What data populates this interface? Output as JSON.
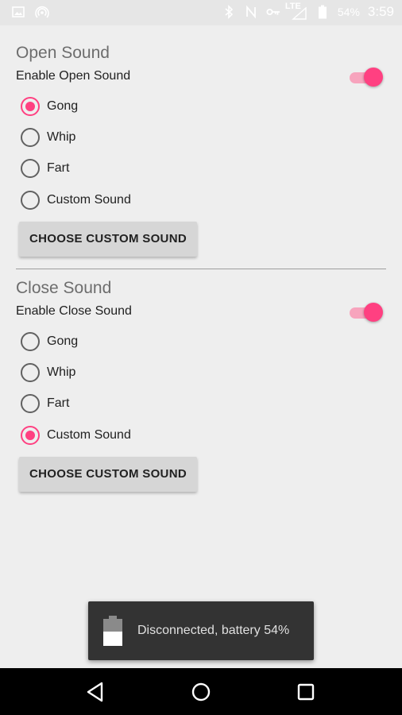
{
  "status_bar": {
    "battery_text": "54%",
    "time": "3:59",
    "network": "LTE",
    "icons": [
      "image-icon",
      "hotspot-icon",
      "bluetooth-icon",
      "nfc-icon",
      "vpn-key-icon",
      "signal-icon",
      "battery-icon"
    ]
  },
  "open_section": {
    "title": "Open Sound",
    "enable_label": "Enable Open Sound",
    "enabled": true,
    "options": [
      {
        "label": "Gong",
        "selected": true
      },
      {
        "label": "Whip",
        "selected": false
      },
      {
        "label": "Fart",
        "selected": false
      },
      {
        "label": "Custom Sound",
        "selected": false
      }
    ],
    "button_label": "CHOOSE CUSTOM SOUND"
  },
  "close_section": {
    "title": "Close Sound",
    "enable_label": "Enable Close Sound",
    "enabled": true,
    "options": [
      {
        "label": "Gong",
        "selected": false
      },
      {
        "label": "Whip",
        "selected": false
      },
      {
        "label": "Fart",
        "selected": false
      },
      {
        "label": "Custom Sound",
        "selected": true
      }
    ],
    "button_label": "CHOOSE CUSTOM SOUND"
  },
  "toast": {
    "text": "Disconnected, battery 54%",
    "battery_level": 0.54
  },
  "nav": {
    "buttons": [
      "back-icon",
      "home-icon",
      "recents-icon"
    ]
  },
  "colors": {
    "accent": "#ff4081",
    "accent_track": "#f7a4bd",
    "background": "#eeeeee"
  }
}
